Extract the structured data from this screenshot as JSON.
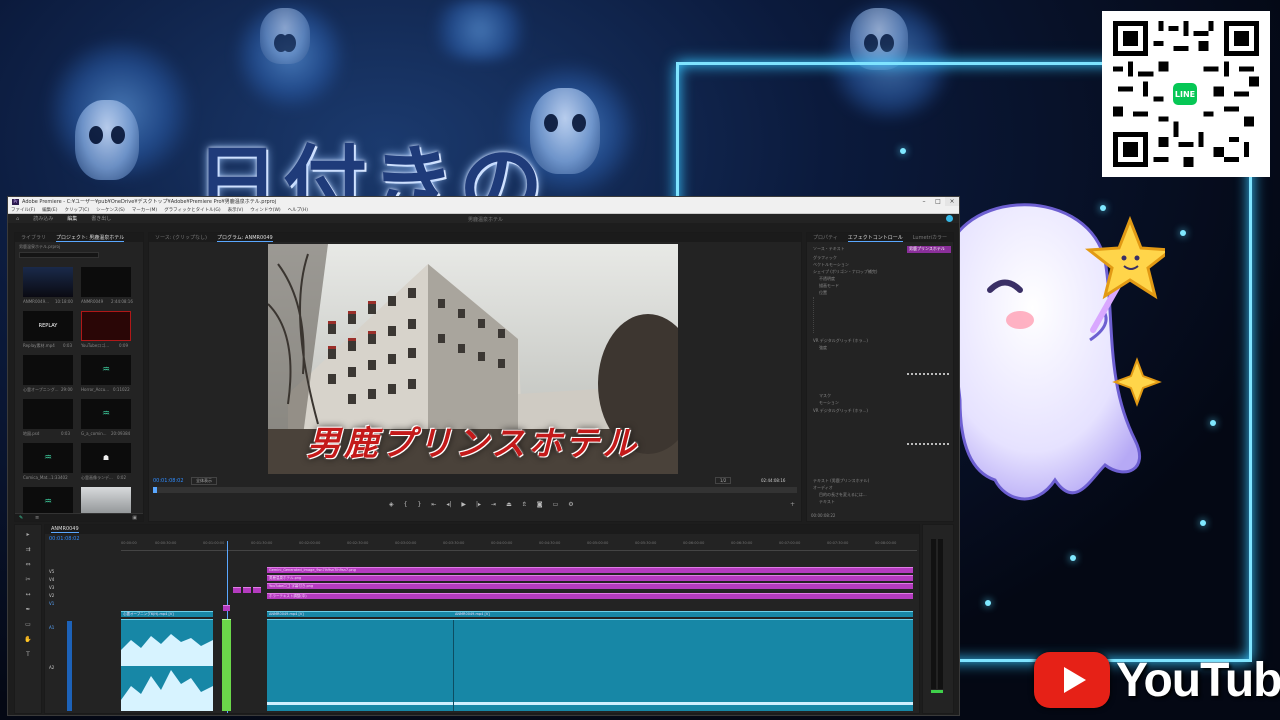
{
  "background": {
    "title_text": "日付きの",
    "accent_color": "#7fe4ff",
    "qr_badge": "LINE",
    "youtube_word": "YouTube"
  },
  "app": {
    "window_title": "Adobe Premiere - C:¥ユーザー¥pub¥OneDrive¥デスクトップ¥Adobe¥Premiere Pro¥男鹿温泉ホテル.prproj",
    "menu": [
      "ファイル(F)",
      "編集(E)",
      "クリップ(C)",
      "シーケンス(S)",
      "マーカー(M)",
      "グラフィックとタイトル(G)",
      "表示(V)",
      "ウィンドウ(W)",
      "ヘルプ(H)"
    ],
    "workspace_tabs": [
      "読み込み",
      "編集",
      "書き出し"
    ],
    "center_title": "男鹿温泉ホテル",
    "project_panel": {
      "tabs": [
        "ライブラリ",
        "プロジェクト: 男鹿温泉ホテル"
      ],
      "project_name": "男鹿温泉ホテル.prproj",
      "items": [
        {
          "name": "ANMR0049...",
          "dur": "10:18:00"
        },
        {
          "name": "ANMR0049",
          "dur": "2:44:08:16"
        },
        {
          "name": "Replay素材.mp4",
          "dur": "0:03"
        },
        {
          "name": "YouTubeロゴ...",
          "dur": "0:09"
        },
        {
          "name": "心霊オープニング...",
          "dur": "29:00"
        },
        {
          "name": "Horror_Accu...",
          "dur": "0:11022"
        },
        {
          "name": "地図.psd",
          "dur": "0:03"
        },
        {
          "name": "G_a_comin...",
          "dur": "20:09384"
        },
        {
          "name": "Comica_Mat...",
          "dur": "1:33402"
        },
        {
          "name": "心霊画像ランデ...",
          "dur": "0:02"
        }
      ],
      "replay_label": "REPLAY"
    },
    "program_panel": {
      "tabs": [
        "ソース: (クリップなし)",
        "プログラム: ANMR0049"
      ],
      "overlay_title": "男鹿プリンスホテル",
      "timecode_current": "00:01:08:02",
      "fit": "全体表示",
      "quality": "1/2",
      "timecode_total": "02:44:08:16"
    },
    "effects_panel": {
      "tabs": [
        "プロパティ",
        "エフェクトコントロール",
        "Lumetriカラー"
      ],
      "clip_label": "男鹿プリンスホテル",
      "rows": [
        "ソース・テキスト",
        "グラフィック",
        "ベクトルモーション",
        "シェイプ (ポリゴン・ナロップ補完)",
        "不透明度",
        "描画モード",
        "位置",
        "VR デジタルグリッチ (ホラ...)",
        "強度",
        "マスク",
        "モーション",
        "VR デジタルグリッチ (ホラ...)",
        "テキスト (男鹿プリンスホテル)",
        "オーディオ",
        "目的の長さを変えるには...",
        "テキスト"
      ],
      "timecode": "00:00:08:22"
    },
    "timeline": {
      "sequence_tab": "ANMR0049",
      "timecode": "00:01:08:02",
      "ruler": [
        "00:00:00",
        "00:00:30:00",
        "00:01:00:00",
        "00:01:30:00",
        "00:02:00:00",
        "00:02:30:00",
        "00:03:00:00",
        "00:03:30:00",
        "00:04:00:00",
        "00:04:30:00",
        "00:05:00:00",
        "00:05:30:00",
        "00:06:00:00",
        "00:06:30:00",
        "00:07:00:00",
        "00:07:30:00",
        "00:08:00:00"
      ],
      "video_tracks": [
        "V5",
        "V4",
        "V3",
        "V2",
        "V1"
      ],
      "audio_tracks": [
        "A1",
        "A2"
      ],
      "clips": {
        "v5": "Gemini_Generated_Image_9sn7lh9sn7lh9sn7.png",
        "v4": "男鹿温泉ホテル.png",
        "v3": "YouTubeロゴ 字幕付き.png",
        "v2": "ホラーテキスト調整(中)",
        "v1_a": "心霊オープニング6(H).mp4 [V]",
        "v1_b": "ANMR0049.mp4 [V]",
        "v1_c": "ANMR0049.mp4 [V]"
      }
    }
  }
}
